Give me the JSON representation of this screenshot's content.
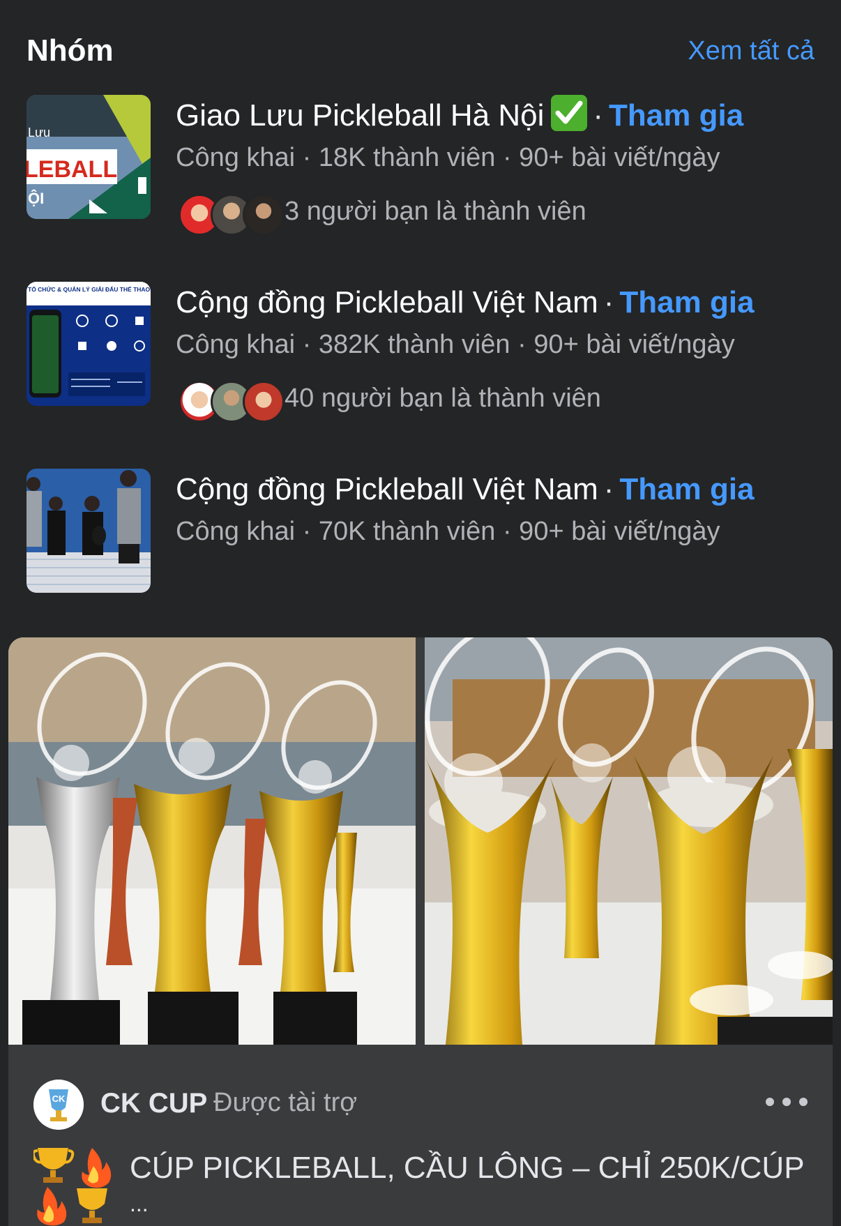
{
  "section": {
    "title": "Nhóm",
    "see_all": "Xem tất cả"
  },
  "groups": [
    {
      "name": "Giao Lưu Pickleball Hà Nội",
      "verified_icon": "check-mark-emoji",
      "separator": "·",
      "join": "Tham gia",
      "meta": "Công khai · 18K thành viên · 90+ bài viết/ngày",
      "friends": "3 người bạn là thành viên",
      "thumb_text": "LEBALL"
    },
    {
      "name": "Cộng đồng Pickleball Việt Nam",
      "separator": "·",
      "join": "Tham gia",
      "meta": "Công khai · 382K thành viên · 90+ bài viết/ngày",
      "friends": "40 người bạn là thành viên",
      "thumb_text": "TỔ CHỨC & QUẢN LÝ GIẢI ĐẤU THỂ THAO CHUYÊN NGHIỆP, UY TÍN"
    },
    {
      "name": "Cộng đồng Pickleball Việt Nam",
      "separator": "·",
      "join": "Tham gia",
      "meta": "Công khai · 70K thành viên · 90+ bài viết/ngày"
    }
  ],
  "ad": {
    "sponsor_name": "CK CUP",
    "sponsor_label": "Được tài trợ",
    "logo_text": "CK",
    "headline": "CÚP PICKLEBALL, CẦU LÔNG – CHỈ 250K/CÚP",
    "ellipsis": "...",
    "emoji_icons": [
      "trophy-emoji",
      "fire-emoji",
      "fire-emoji",
      "trophy-emoji"
    ]
  },
  "colors": {
    "background": "#242526",
    "card": "#3a3b3c",
    "link": "#4599ff",
    "secondary_text": "#b0b3b8",
    "verified_green": "#4caf2e",
    "gold": "#d8a514"
  }
}
